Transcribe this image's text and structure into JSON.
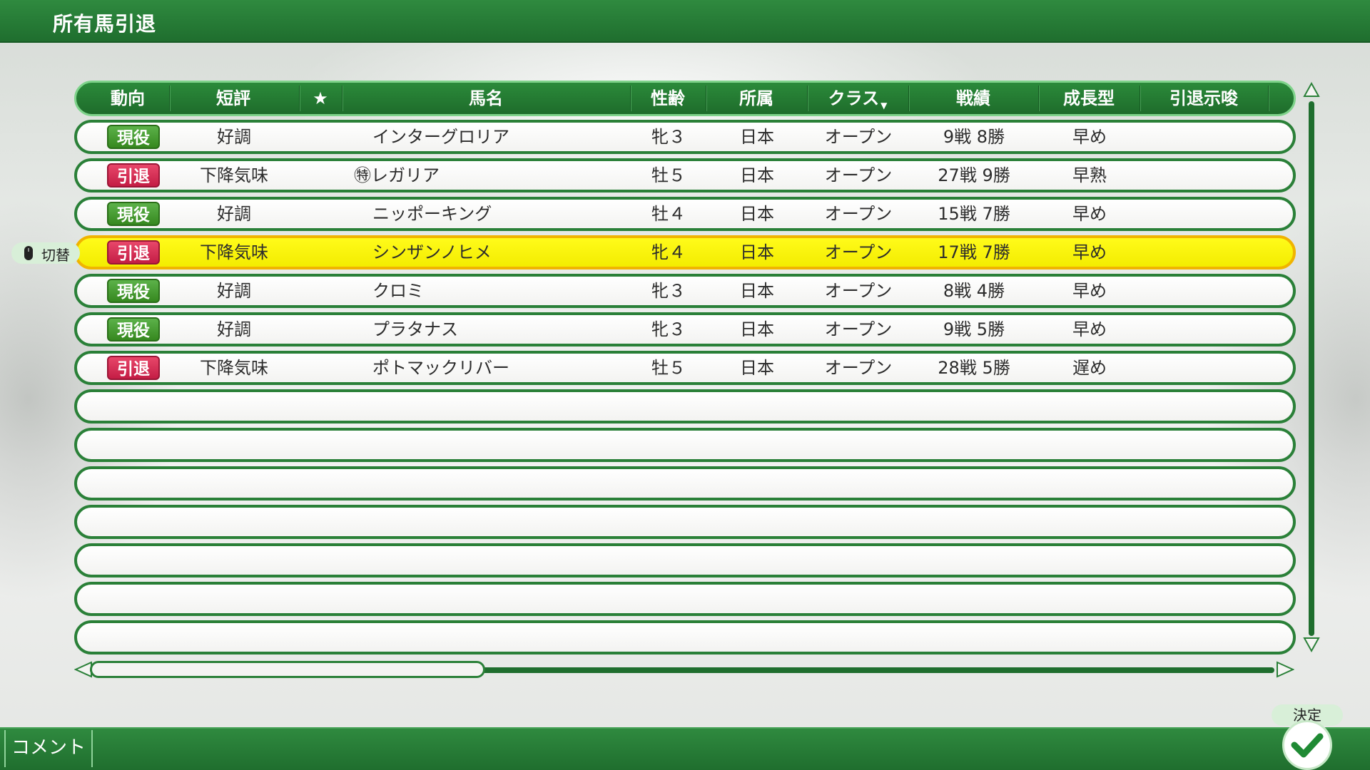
{
  "title": "所有馬引退",
  "columns": [
    "動向",
    "短評",
    "★",
    "馬名",
    "性齢",
    "所属",
    "クラス",
    "戦績",
    "成長型",
    "引退示唆"
  ],
  "rows": [
    {
      "status": "現役",
      "status_color": "green",
      "comment": "好調",
      "name": "インターグロリア",
      "sex_age": "牝３",
      "affiliation": "日本",
      "class": "オープン",
      "record": "9戦 8勝",
      "growth": "早め"
    },
    {
      "status": "引退",
      "status_color": "red",
      "comment": "下降気味",
      "name": "㊕レガリア",
      "sex_age": "牡５",
      "affiliation": "日本",
      "class": "オープン",
      "record": "27戦 9勝",
      "growth": "早熟"
    },
    {
      "status": "現役",
      "status_color": "green",
      "comment": "好調",
      "name": "ニッポーキング",
      "sex_age": "牡４",
      "affiliation": "日本",
      "class": "オープン",
      "record": "15戦 7勝",
      "growth": "早め"
    },
    {
      "status": "引退",
      "status_color": "red",
      "comment": "下降気味",
      "name": "シンザンノヒメ",
      "sex_age": "牝４",
      "affiliation": "日本",
      "class": "オープン",
      "record": "17戦 7勝",
      "growth": "早め"
    },
    {
      "status": "現役",
      "status_color": "green",
      "comment": "好調",
      "name": "クロミ",
      "sex_age": "牝３",
      "affiliation": "日本",
      "class": "オープン",
      "record": "8戦 4勝",
      "growth": "早め"
    },
    {
      "status": "現役",
      "status_color": "green",
      "comment": "好調",
      "name": "プラタナス",
      "sex_age": "牝３",
      "affiliation": "日本",
      "class": "オープン",
      "record": "9戦 5勝",
      "growth": "早め"
    },
    {
      "status": "引退",
      "status_color": "red",
      "comment": "下降気味",
      "name": "ポトマックリバー",
      "sex_age": "牡５",
      "affiliation": "日本",
      "class": "オープン",
      "record": "28戦 5勝",
      "growth": "遅め"
    }
  ],
  "selected_row": 3,
  "switch_label": "切替",
  "comment_button": "コメント",
  "confirm_label": "決定",
  "icons": {
    "mouse": "mouse-icon",
    "confirm": "checkmark-icon",
    "sort": "sort-down-icon",
    "scroll_up": "arrow-up-icon",
    "scroll_down": "arrow-down-icon",
    "scroll_left": "arrow-left-icon",
    "scroll_right": "arrow-right-icon"
  },
  "colors": {
    "bar_green": "#1f6e2e",
    "selected": "#fff200",
    "badge_green": "#43961f",
    "badge_red": "#d22851"
  }
}
